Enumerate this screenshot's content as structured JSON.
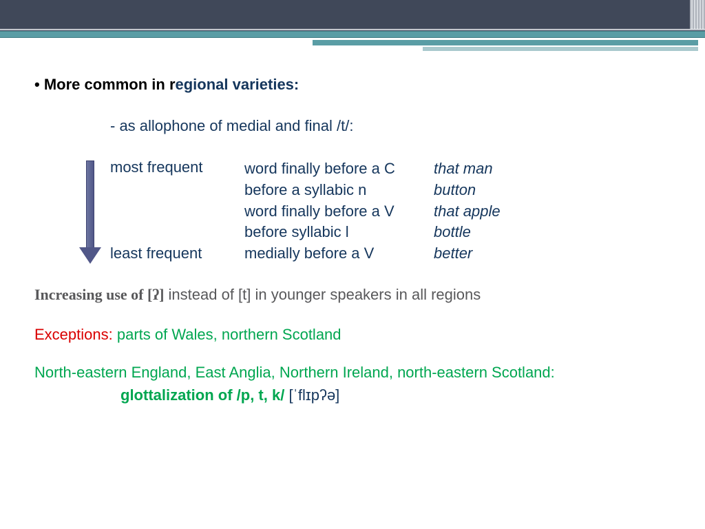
{
  "header": {
    "bullet_black": "• More common in r",
    "bullet_rest": "egional varieties:"
  },
  "sub": "- as allophone of medial and final /t/:",
  "frequency": {
    "most": "most frequent",
    "least": "least frequent"
  },
  "rows": {
    "d1": "word finally before a C",
    "d2": "before a syllabic n",
    "d3": "word finally before a V",
    "d4": "before syllabic  l",
    "d5": "medially before a V",
    "e1": "that man",
    "e2": "button",
    "e3": "that apple",
    "e4": "bottle",
    "e5": "better"
  },
  "increasing": {
    "bold": "Increasing use of [ʔ]",
    "rest": " instead of [t] in younger speakers in all regions"
  },
  "exceptions": {
    "label": "Exceptions:",
    "text": " parts of Wales, northern Scotland"
  },
  "ne_england": "North-eastern England, East Anglia, Northern Ireland, north-eastern Scotland:",
  "glottal": {
    "text": "glottalization of /p, t, k/",
    "ipa": "  [ˈflɪpʔə]"
  }
}
